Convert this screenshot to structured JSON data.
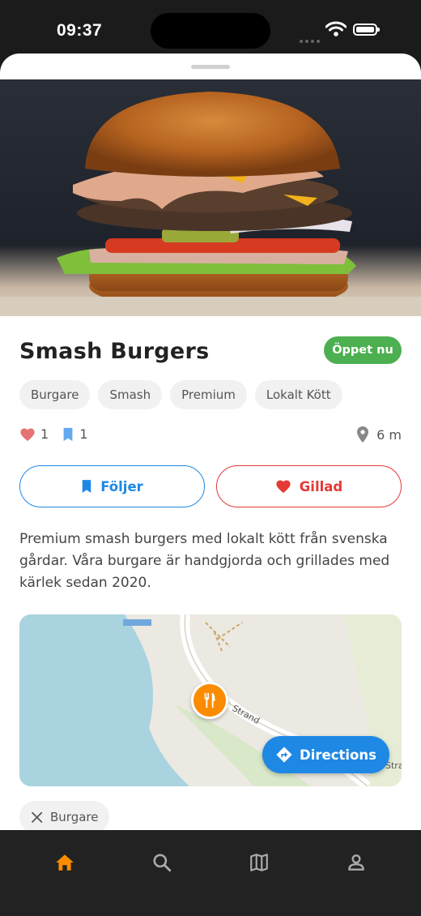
{
  "status_bar": {
    "time": "09:37"
  },
  "place": {
    "name": "Smash Burgers",
    "status": "Öppet nu",
    "tags": [
      "Burgare",
      "Smash",
      "Premium",
      "Lokalt Kött"
    ],
    "likes": "1",
    "bookmarks": "1",
    "distance": "6 m",
    "description": "Premium smash burgers med lokalt kött från svenska gårdar. Våra burgare är handgjorda och grillades med kärlek sedan 2020."
  },
  "actions": {
    "follow_label": "Följer",
    "like_label": "Gillad"
  },
  "map": {
    "street_label": "Strand",
    "street_label_2": "Stra",
    "directions_label": "Directions"
  },
  "category": {
    "label": "Burgare"
  },
  "nav": {
    "items": [
      "home-icon",
      "search-icon",
      "map-icon",
      "profile-icon"
    ],
    "active": "home-icon"
  },
  "colors": {
    "accent": "#fb8c00",
    "open": "#4caf50",
    "follow": "#1e88e5",
    "like": "#e53935",
    "nav_bg": "#222222"
  }
}
